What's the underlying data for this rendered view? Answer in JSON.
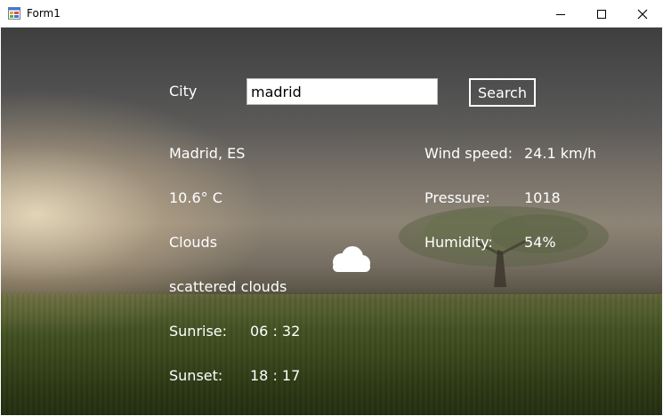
{
  "window": {
    "title": "Form1"
  },
  "search": {
    "label": "City",
    "value": "madrid",
    "button_label": "Search"
  },
  "weather": {
    "location": "Madrid, ES",
    "temperature": "10.6° C",
    "main": "Clouds",
    "description": "scattered clouds",
    "icon": "cloud-icon",
    "sunrise_label": "Sunrise:",
    "sunrise_value": "06 : 32",
    "sunset_label": "Sunset:",
    "sunset_value": "18 : 17",
    "wind_label": "Wind speed:",
    "wind_value": "24.1 km/h",
    "pressure_label": "Pressure:",
    "pressure_value": "1018",
    "humidity_label": "Humidity:",
    "humidity_value": "54%"
  }
}
